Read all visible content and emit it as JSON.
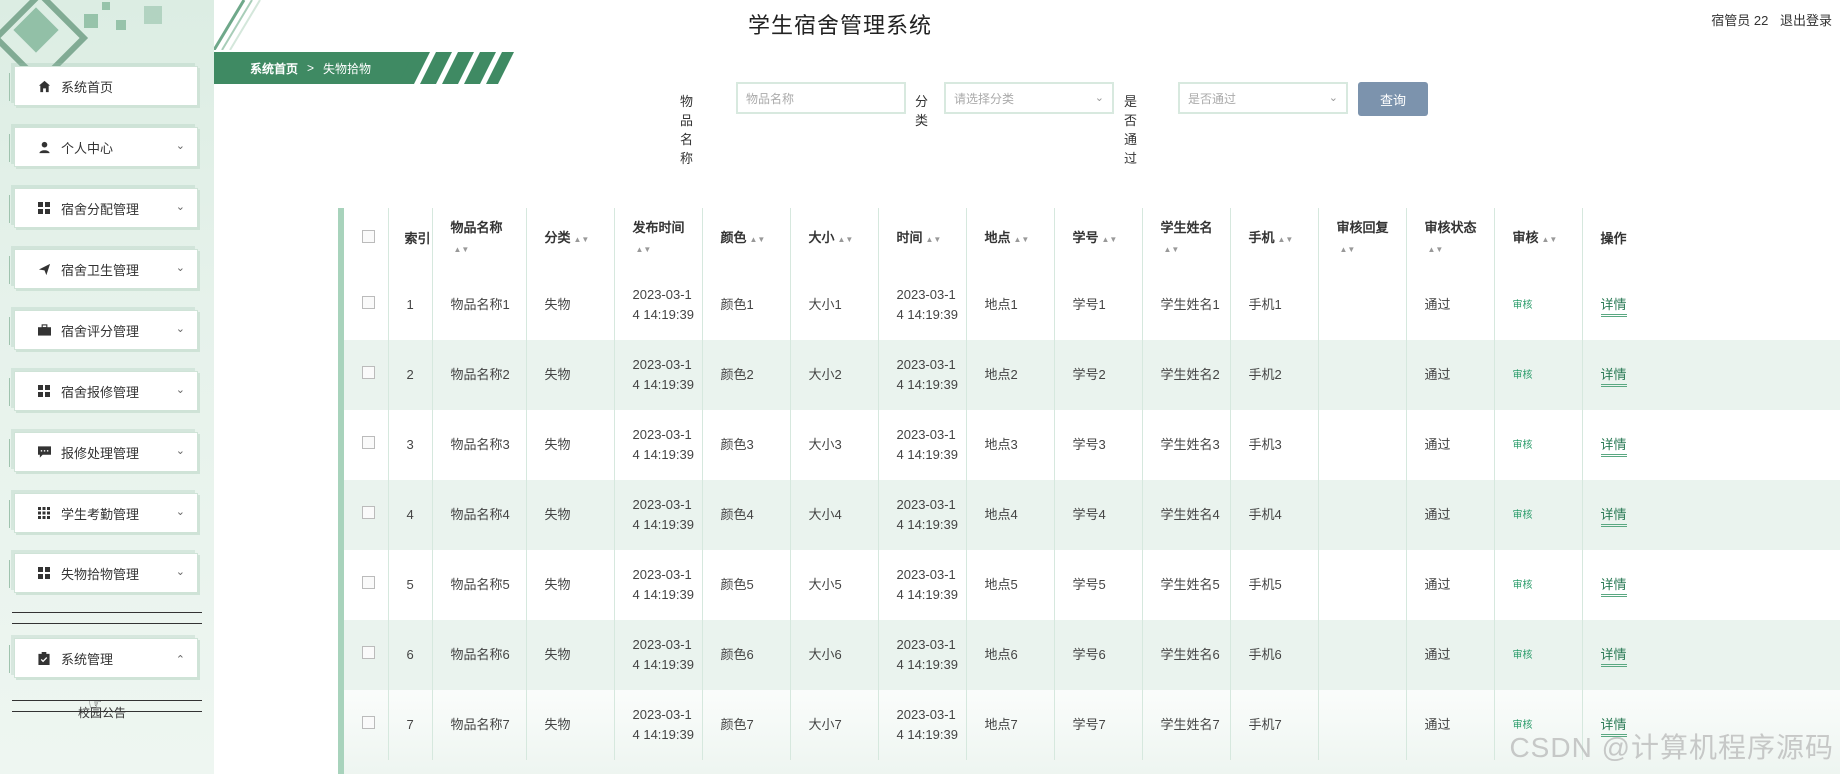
{
  "header": {
    "title": "学生宿舍管理系统",
    "user_label": "宿管员 22",
    "logout_label": "退出登录"
  },
  "sidebar": {
    "items": [
      {
        "label": "系统首页",
        "icon": "home-icon"
      },
      {
        "label": "个人中心",
        "icon": "person-icon"
      },
      {
        "label": "宿舍分配管理",
        "icon": "grid-icon"
      },
      {
        "label": "宿舍卫生管理",
        "icon": "send-icon"
      },
      {
        "label": "宿舍评分管理",
        "icon": "briefcase-icon"
      },
      {
        "label": "宿舍报修管理",
        "icon": "grid-icon"
      },
      {
        "label": "报修处理管理",
        "icon": "chat-icon"
      },
      {
        "label": "学生考勤管理",
        "icon": "apps-icon"
      },
      {
        "label": "失物拾物管理",
        "icon": "grid-icon"
      },
      {
        "label": "系统管理",
        "icon": "clipboard-icon"
      }
    ],
    "submenu_label": "校园公告"
  },
  "breadcrumb": {
    "home": "系统首页",
    "separator": ">",
    "current": "失物拾物"
  },
  "search": {
    "name_label": "物品名称",
    "name_placeholder": "物品名称",
    "category_label": "分类",
    "category_placeholder": "请选择分类",
    "approved_label": "是否通过",
    "approved_placeholder": "是否通过",
    "button_label": "查询"
  },
  "table": {
    "headers": [
      "索引",
      "物品名称",
      "分类",
      "发布时间",
      "颜色",
      "大小",
      "时间",
      "地点",
      "学号",
      "学生姓名",
      "手机",
      "审核回复",
      "审核状态",
      "审核",
      "操作"
    ],
    "rows": [
      {
        "index": "1",
        "name": "物品名称1",
        "category": "失物",
        "publish_time": "2023-03-14 14:19:39",
        "color": "颜色1",
        "size": "大小1",
        "time": "2023-03-14 14:19:39",
        "place": "地点1",
        "student_no": "学号1",
        "student_name": "学生姓名1",
        "phone": "手机1",
        "reply": "",
        "status": "通过",
        "audit": "审核",
        "action": "详情"
      },
      {
        "index": "2",
        "name": "物品名称2",
        "category": "失物",
        "publish_time": "2023-03-14 14:19:39",
        "color": "颜色2",
        "size": "大小2",
        "time": "2023-03-14 14:19:39",
        "place": "地点2",
        "student_no": "学号2",
        "student_name": "学生姓名2",
        "phone": "手机2",
        "reply": "",
        "status": "通过",
        "audit": "审核",
        "action": "详情"
      },
      {
        "index": "3",
        "name": "物品名称3",
        "category": "失物",
        "publish_time": "2023-03-14 14:19:39",
        "color": "颜色3",
        "size": "大小3",
        "time": "2023-03-14 14:19:39",
        "place": "地点3",
        "student_no": "学号3",
        "student_name": "学生姓名3",
        "phone": "手机3",
        "reply": "",
        "status": "通过",
        "audit": "审核",
        "action": "详情"
      },
      {
        "index": "4",
        "name": "物品名称4",
        "category": "失物",
        "publish_time": "2023-03-14 14:19:39",
        "color": "颜色4",
        "size": "大小4",
        "time": "2023-03-14 14:19:39",
        "place": "地点4",
        "student_no": "学号4",
        "student_name": "学生姓名4",
        "phone": "手机4",
        "reply": "",
        "status": "通过",
        "audit": "审核",
        "action": "详情"
      },
      {
        "index": "5",
        "name": "物品名称5",
        "category": "失物",
        "publish_time": "2023-03-14 14:19:39",
        "color": "颜色5",
        "size": "大小5",
        "time": "2023-03-14 14:19:39",
        "place": "地点5",
        "student_no": "学号5",
        "student_name": "学生姓名5",
        "phone": "手机5",
        "reply": "",
        "status": "通过",
        "audit": "审核",
        "action": "详情"
      },
      {
        "index": "6",
        "name": "物品名称6",
        "category": "失物",
        "publish_time": "2023-03-14 14:19:39",
        "color": "颜色6",
        "size": "大小6",
        "time": "2023-03-14 14:19:39",
        "place": "地点6",
        "student_no": "学号6",
        "student_name": "学生姓名6",
        "phone": "手机6",
        "reply": "",
        "status": "通过",
        "audit": "审核",
        "action": "详情"
      },
      {
        "index": "7",
        "name": "物品名称7",
        "category": "失物",
        "publish_time": "2023-03-14 14:19:39",
        "color": "颜色7",
        "size": "大小7",
        "time": "2023-03-14 14:19:39",
        "place": "地点7",
        "student_no": "学号7",
        "student_name": "学生姓名7",
        "phone": "手机7",
        "reply": "",
        "status": "通过",
        "audit": "审核",
        "action": "详情"
      }
    ]
  },
  "watermark": "CSDN @计算机程序源码",
  "colors": {
    "accent": "#3f8a63",
    "button": "#7c93ad",
    "sidebar_bg": "#e6f2eb"
  }
}
